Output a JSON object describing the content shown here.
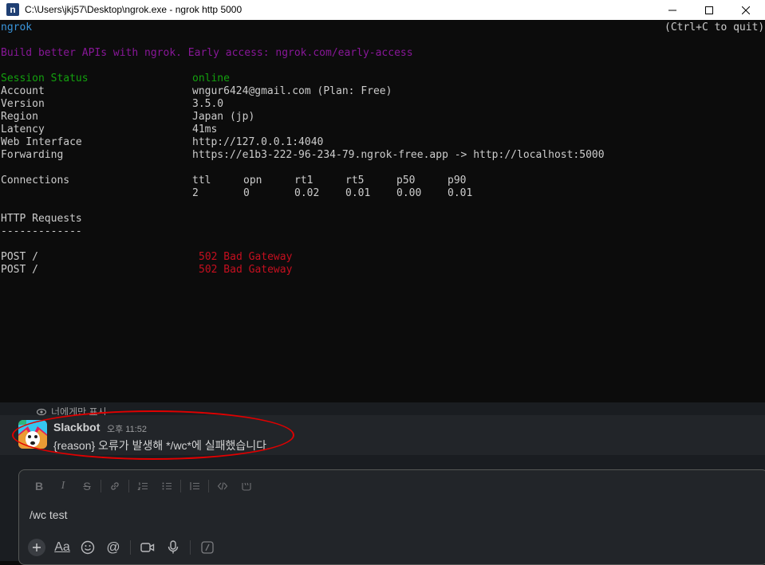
{
  "window": {
    "title": "C:\\Users\\jkj57\\Desktop\\ngrok.exe - ngrok  http 5000",
    "app_icon_letter": "n",
    "controls": [
      "minimize-icon",
      "maximize-icon",
      "close-icon"
    ]
  },
  "terminal": {
    "app_name": "ngrok",
    "quit_hint": "(Ctrl+C to quit)",
    "promo": "Build better APIs with ngrok. Early access: ngrok.com/early-access",
    "session_status_label": "Session Status",
    "session_status_value": "online",
    "rows": [
      {
        "label": "Account",
        "value": "wngur6424@gmail.com (Plan: Free)"
      },
      {
        "label": "Version",
        "value": "3.5.0"
      },
      {
        "label": "Region",
        "value": "Japan (jp)"
      },
      {
        "label": "Latency",
        "value": "41ms"
      },
      {
        "label": "Web Interface",
        "value": "http://127.0.0.1:4040"
      },
      {
        "label": "Forwarding",
        "value": "https://e1b3-222-96-234-79.ngrok-free.app -> http://localhost:5000"
      }
    ],
    "connections_label": "Connections",
    "connections_headers": [
      "ttl",
      "opn",
      "rt1",
      "rt5",
      "p50",
      "p90"
    ],
    "connections_values": [
      "2",
      "0",
      "0.02",
      "0.01",
      "0.00",
      "0.01"
    ],
    "http_requests_label": "HTTP Requests",
    "http_requests_underline": "-------------",
    "requests": [
      {
        "method": "POST /",
        "status": "502 Bad Gateway"
      },
      {
        "method": "POST /",
        "status": "502 Bad Gateway"
      }
    ],
    "colors": {
      "background": "#0c0c0c",
      "text": "#cccccc",
      "cyan": "#3a96dd",
      "magenta": "#881798",
      "green": "#13a10e",
      "red": "#c50f1f"
    }
  },
  "slack": {
    "visibility_note": "너에게만 표시",
    "message": {
      "sender": "Slackbot",
      "time": "오후 11:52",
      "text": "{reason} 오류가 발생해 */wc*에 실패했습니다."
    },
    "composer": {
      "value": "/wc test",
      "format_buttons": [
        "bold-icon",
        "italic-icon",
        "strikethrough-icon",
        "link-icon",
        "ordered-list-icon",
        "bulleted-list-icon",
        "blockquote-icon",
        "code-icon",
        "code-block-icon"
      ],
      "format_labels": {
        "bold": "B",
        "italic": "I",
        "strike": "S"
      },
      "action_buttons": [
        "plus-icon",
        "text-format-icon",
        "emoji-icon",
        "mention-icon",
        "video-icon",
        "microphone-icon",
        "shortcut-icon"
      ],
      "text_format_label": "Aa",
      "mention_label": "@"
    }
  }
}
